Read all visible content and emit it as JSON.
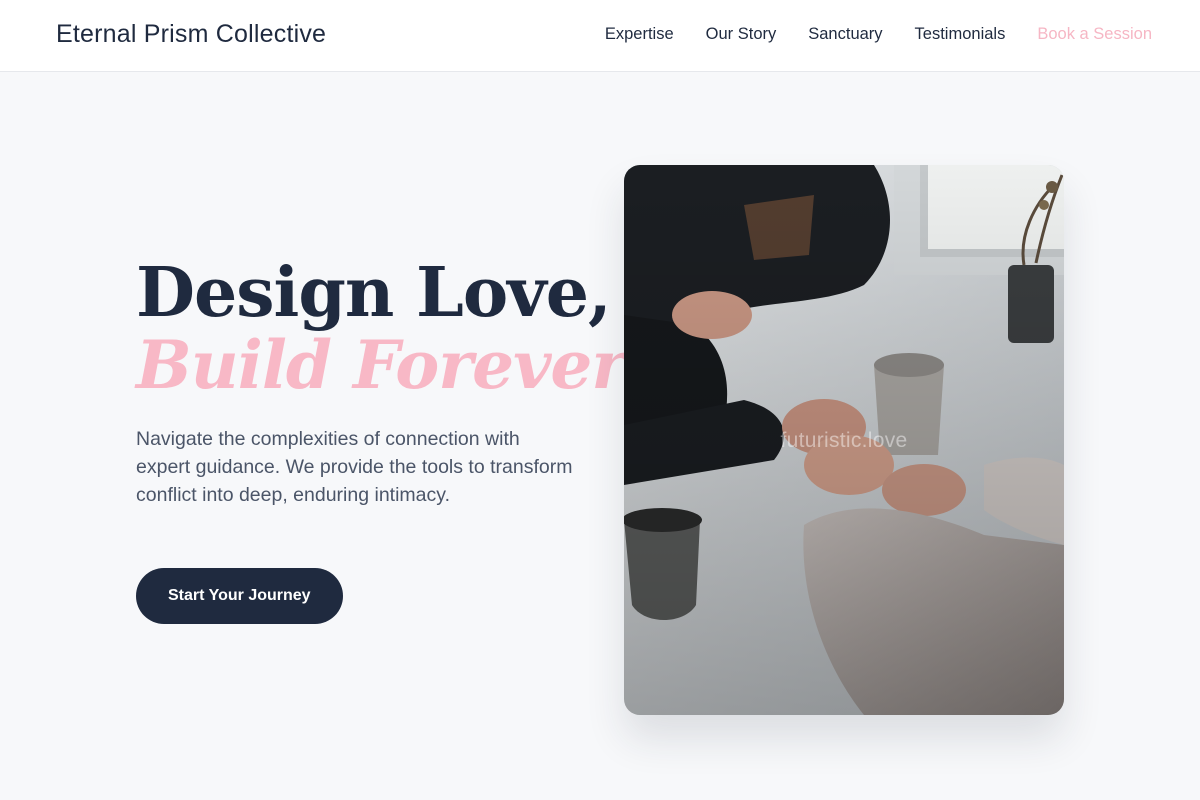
{
  "brand": {
    "name": "Eternal Prism Collective"
  },
  "nav": {
    "links": [
      {
        "label": "Expertise"
      },
      {
        "label": "Our Story"
      },
      {
        "label": "Sanctuary"
      },
      {
        "label": "Testimonials"
      },
      {
        "label": "Book a Session"
      }
    ]
  },
  "hero": {
    "headline": "Design Love,",
    "headline_accent": "Build Forever.",
    "lead": "Navigate the complexities of connection with expert guidance. We provide the tools to transform conflict into deep, enduring intimacy.",
    "cta_label": "Start Your Journey",
    "image": {
      "subject": "couple-holding-hands-at-table-photo",
      "watermark": "futuristic.love"
    }
  },
  "colors": {
    "primary": "#1f2a3f",
    "accent_pink": "#f8b8c6",
    "background": "#f7f8fa",
    "body_text": "#4b5568"
  }
}
